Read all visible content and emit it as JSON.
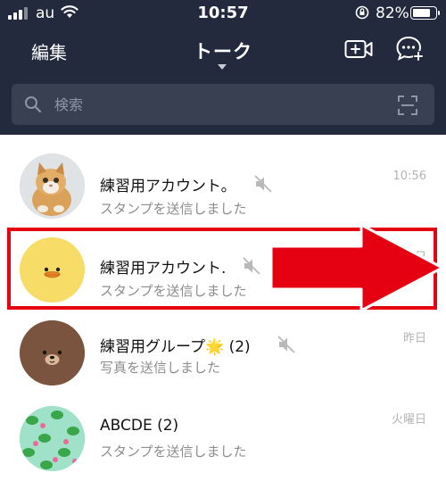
{
  "status_bar": {
    "carrier": "au",
    "time": "10:57",
    "battery": "82%",
    "battery_level": 0.82
  },
  "header": {
    "edit_label": "編集",
    "title": "トーク"
  },
  "search": {
    "placeholder": "検索"
  },
  "chats": [
    {
      "name": "練習用アカウント。",
      "preview": "スタンプを送信しました",
      "time": "10:56",
      "muted": true,
      "avatar": "kitten-photo-avatar"
    },
    {
      "name": "練習用アカウント.",
      "preview": "スタンプを送信しました",
      "time": "昨日",
      "muted": true,
      "avatar": "sally-duck-avatar"
    },
    {
      "name": "練習用グループ",
      "badge": "🌟",
      "count": "(2)",
      "preview": "写真を送信しました",
      "time": "昨日",
      "muted": true,
      "avatar": "brown-bear-avatar"
    },
    {
      "name": "ABCDE",
      "count": "(2)",
      "preview": "スタンプを送信しました",
      "time": "火曜日",
      "muted": false,
      "avatar": "frog-pattern-avatar"
    }
  ],
  "colors": {
    "header_bg": "#232a3d",
    "search_bg": "#384052",
    "highlight": "#e50012",
    "arrow": "#e50012"
  }
}
